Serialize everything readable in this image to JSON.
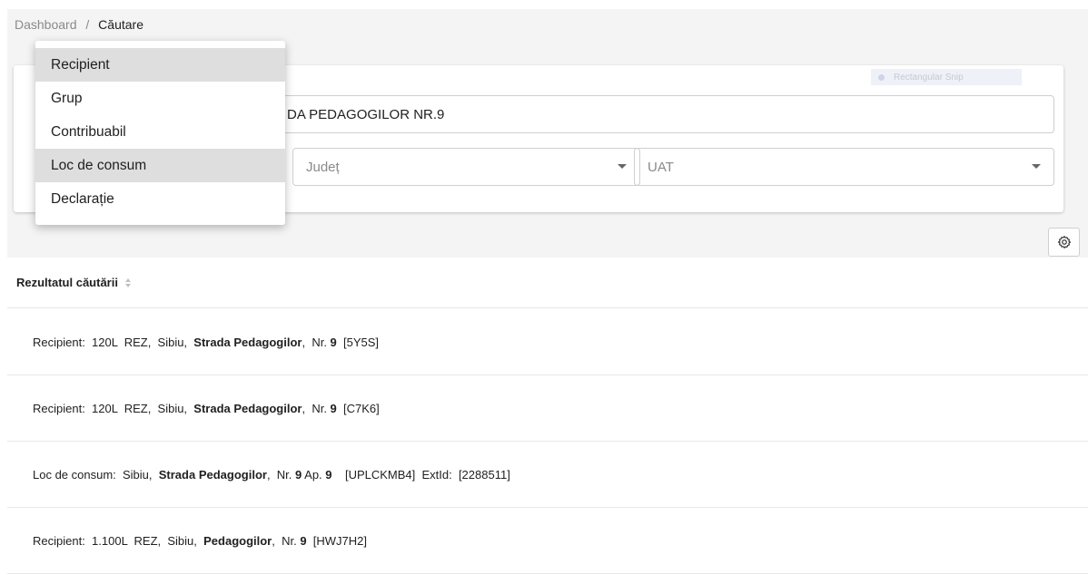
{
  "breadcrumb": {
    "root": "Dashboard",
    "separator": "/",
    "current": "Căutare"
  },
  "snip_label": "Rectangular Snip",
  "search": {
    "value": "DA PEDAGOGILOR NR.9"
  },
  "filters": {
    "judet_placeholder": "Județ",
    "uat_placeholder": "UAT"
  },
  "menu": {
    "items": [
      {
        "label": "Recipient",
        "active": true
      },
      {
        "label": "Grup",
        "active": false
      },
      {
        "label": "Contribuabil",
        "active": false
      },
      {
        "label": "Loc de consum",
        "active": true
      },
      {
        "label": "Declarație",
        "active": false
      }
    ]
  },
  "settings_icon": "gear-icon",
  "results": {
    "header": "Rezultatul căutării",
    "rows": [
      {
        "p1": "Recipient:  120L  REZ,  Sibiu,  ",
        "b1": "Strada Pedagogilor",
        "p2": ",  Nr. ",
        "b2": "9",
        "p3": "  [5Y5S]",
        "b3": "",
        "p4": ""
      },
      {
        "p1": "Recipient:  120L  REZ,  Sibiu,  ",
        "b1": "Strada Pedagogilor",
        "p2": ",  Nr. ",
        "b2": "9",
        "p3": "  [C7K6]",
        "b3": "",
        "p4": ""
      },
      {
        "p1": "Loc de consum:  Sibiu,  ",
        "b1": "Strada Pedagogilor",
        "p2": ",  Nr. ",
        "b2": "9",
        "p3": " Ap. ",
        "b3": "9",
        "p4": "    [UPLCKMB4]  ExtId:  [2288511]"
      },
      {
        "p1": "Recipient:  1.100L  REZ,  Sibiu,  ",
        "b1": "Pedagogilor",
        "p2": ",  Nr. ",
        "b2": "9",
        "p3": "  [HWJ7H2]",
        "b3": "",
        "p4": ""
      }
    ]
  }
}
